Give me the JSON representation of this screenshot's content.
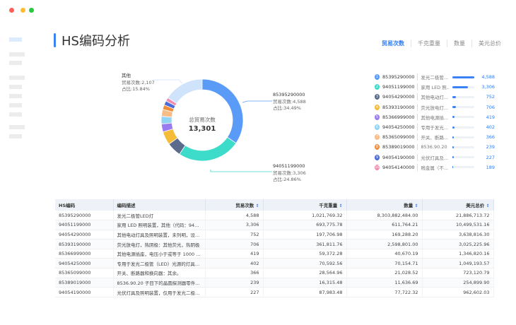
{
  "window": {
    "controls": [
      {
        "name": "close",
        "color": "#ff5f57"
      },
      {
        "name": "minimize",
        "color": "#febc2e"
      },
      {
        "name": "maximize",
        "color": "#28c840"
      }
    ]
  },
  "page_title": "HS编码分析",
  "metric_tabs": [
    {
      "label": "贸易次数",
      "active": true
    },
    {
      "label": "千克重量",
      "active": false
    },
    {
      "label": "数量",
      "active": false
    },
    {
      "label": "美元总价",
      "active": false
    }
  ],
  "chart_data": {
    "type": "pie",
    "center_label": "总贸易次数",
    "center_value": "13,301",
    "slices": [
      {
        "name": "85395290000",
        "value": 4588,
        "color": "#5b9bf8"
      },
      {
        "name": "94051199000",
        "value": 3306,
        "color": "#3ddbc9"
      },
      {
        "name": "94054290000",
        "value": 752,
        "color": "#5b6b8c"
      },
      {
        "name": "85393190000",
        "value": 706,
        "color": "#f5bc3a"
      },
      {
        "name": "85366999000",
        "value": 419,
        "color": "#9b7bf0"
      },
      {
        "name": "94054250000",
        "value": 402,
        "color": "#8fd3f5"
      },
      {
        "name": "85365099000",
        "value": 366,
        "color": "#f8bc86"
      },
      {
        "name": "85389019000",
        "value": 239,
        "color": "#f28e3c"
      },
      {
        "name": "94054190000",
        "value": 227,
        "color": "#4a6bd8"
      },
      {
        "name": "94054140000",
        "value": 189,
        "color": "#f08cb0"
      },
      {
        "name": "其他",
        "value": 2107,
        "color": "#cfe3fb"
      }
    ],
    "annotations": [
      {
        "name": "其他",
        "count": "贸易次数:2,107",
        "share": "占比:15.84%"
      },
      {
        "name": "85395290000",
        "count": "贸易次数:4,588",
        "share": "占比:34.49%"
      },
      {
        "name": "94051199000",
        "count": "贸易次数:3,306",
        "share": "占比:24.86%"
      }
    ]
  },
  "ranking": [
    {
      "rank": "1",
      "code": "85395290000",
      "desc": "发光二极管...",
      "value": "4,588",
      "fraction": 1.0
    },
    {
      "rank": "2",
      "code": "94051199000",
      "desc": "家用 LED 照...",
      "value": "3,306",
      "fraction": 0.72
    },
    {
      "rank": "3",
      "code": "94054290000",
      "desc": "其他电动灯...",
      "value": "752",
      "fraction": 0.16
    },
    {
      "rank": "4",
      "code": "85393190000",
      "desc": "荧光放电灯...",
      "value": "706",
      "fraction": 0.15
    },
    {
      "rank": "5",
      "code": "85366999000",
      "desc": "其他电源插...",
      "value": "419",
      "fraction": 0.09
    },
    {
      "rank": "6",
      "code": "94054250000",
      "desc": "专用于发光...",
      "value": "402",
      "fraction": 0.09
    },
    {
      "rank": "7",
      "code": "85365099000",
      "desc": "开关、断路...",
      "value": "366",
      "fraction": 0.08
    },
    {
      "rank": "8",
      "code": "85389019000",
      "desc": "8536.90.20 ...",
      "value": "239",
      "fraction": 0.05
    },
    {
      "rank": "9",
      "code": "94054190000",
      "desc": "光伏灯具及...",
      "value": "227",
      "fraction": 0.05
    },
    {
      "rank": "10",
      "code": "94054140000",
      "desc": "贱金属（不...",
      "value": "189",
      "fraction": 0.04
    }
  ],
  "table": {
    "headers": [
      "HS编码",
      "编码描述",
      "贸易次数",
      "千克重量",
      "数量",
      "美元总价"
    ],
    "sort_icon": "⇕",
    "rows": [
      [
        "85395290000",
        "发光二极管LED灯",
        "4,588",
        "1,021,769.32",
        "8,303,882,484.00",
        "21,886,713.72"
      ],
      [
        "94051199000",
        "家用 LED 照明装置，其他（代码：9405.1...",
        "3,306",
        "693,775.78",
        "611,764.21",
        "10,499,531.16"
      ],
      [
        "94054290000",
        "其他电动灯具及照明装置，未列明，设计...",
        "752",
        "197,706.98",
        "169,288.20",
        "3,638,816.30"
      ],
      [
        "85393190000",
        "荧光放电灯，热阴极：其他荧光，热阴极",
        "706",
        "361,811.76",
        "2,598,801.00",
        "3,025,225.96"
      ],
      [
        "85366999000",
        "其他电源插座，电压小于或等于 1000 伏：...",
        "419",
        "59,372.28",
        "40,670.19",
        "1,346,820.16"
      ],
      [
        "94054250000",
        "专用于发光二极管（LED）光源的灯具及...",
        "402",
        "70,592.56",
        "70,154.71",
        "1,049,193.57"
      ],
      [
        "85365099000",
        "开关、断路器和换向器：其余。",
        "366",
        "28,564.96",
        "21,028.52",
        "723,120.79"
      ],
      [
        "85389019000",
        "8536.90.20 子目下的晶圆探测器零件，其...",
        "239",
        "16,315.48",
        "11,636.69",
        "254,899.90"
      ],
      [
        "94054190000",
        "光伏灯具及照明装置，仅用于发光二极管...",
        "227",
        "87,983.48",
        "77,722.32",
        "962,602.03"
      ]
    ]
  }
}
